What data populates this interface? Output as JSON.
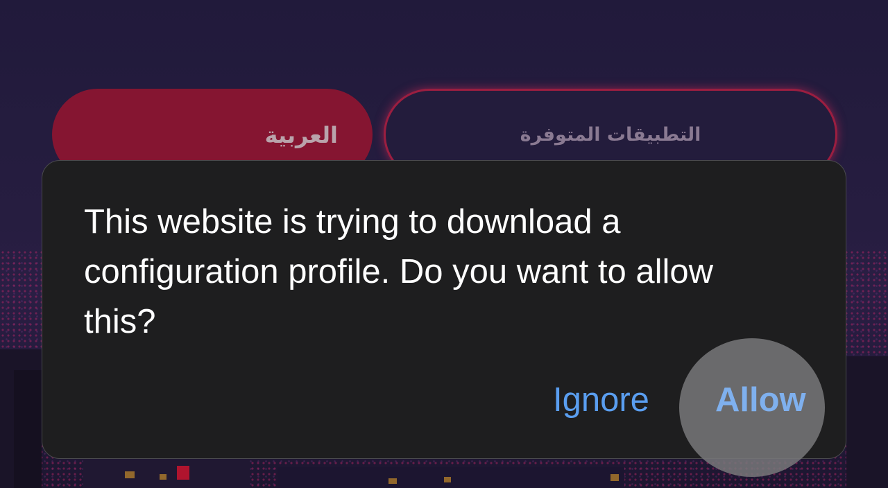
{
  "background": {
    "tabs": [
      {
        "label": "العربية",
        "active": true
      },
      {
        "label": "التطبيقات المتوفرة",
        "active": false
      }
    ]
  },
  "dialog": {
    "message": "This website is trying to download a configuration profile. Do you want to allow this?",
    "buttons": {
      "ignore": "Ignore",
      "allow": "Allow"
    },
    "accent_color": "#5a9ef0"
  }
}
